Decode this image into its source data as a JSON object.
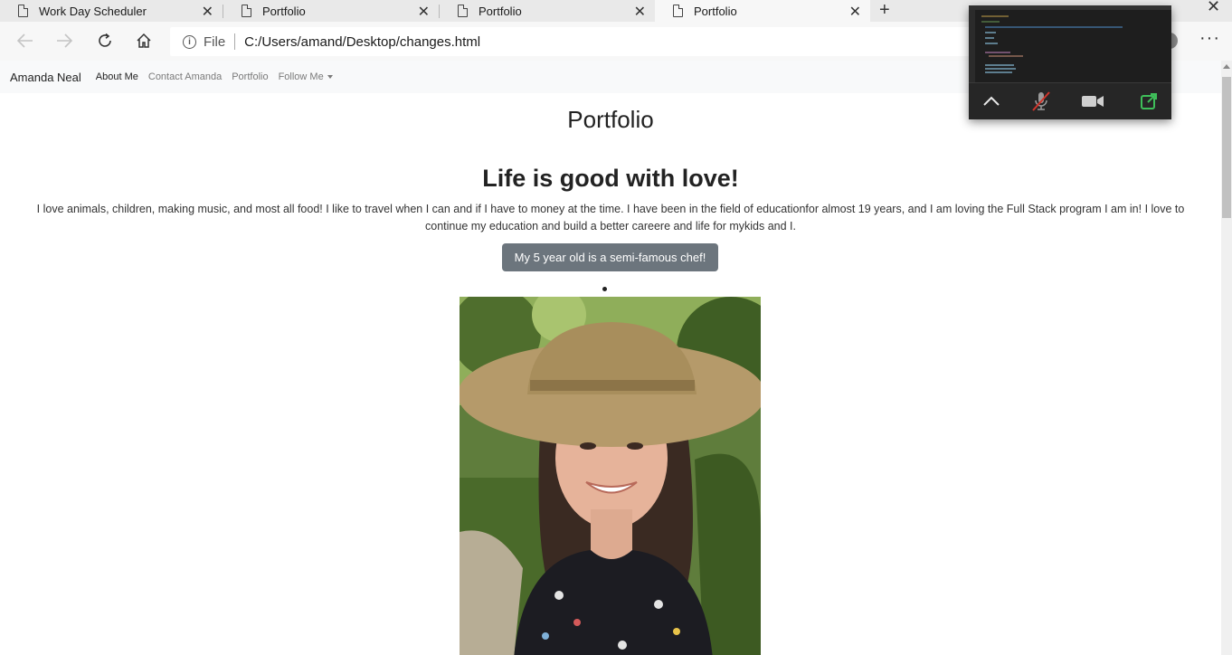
{
  "browser": {
    "tabs": [
      {
        "title": "Work Day Scheduler",
        "active": false
      },
      {
        "title": "Portfolio",
        "active": false
      },
      {
        "title": "Portfolio",
        "active": false
      },
      {
        "title": "Portfolio",
        "active": true
      }
    ],
    "address": {
      "scheme_label": "File",
      "url": "C:/Users/amand/Desktop/changes.html"
    }
  },
  "site": {
    "brand": "Amanda Neal",
    "nav": [
      {
        "label": "About Me",
        "active": true
      },
      {
        "label": "Contact Amanda",
        "active": false
      },
      {
        "label": "Portfolio",
        "active": false
      },
      {
        "label": "Follow Me",
        "active": false,
        "dropdown": true
      }
    ],
    "page_title": "Portfolio",
    "section_title": "Life is good with love!",
    "about_text": "I love animals, children, making music, and most all food! I like to travel when I can and if I have to money at the time. I have been in the field of educationfor almost 19 years, and I am loving the Full Stack program I am in! I love to continue my education and build a better careere and life for mykids and I.",
    "chef_button": "My 5 year old is a semi-famous chef!"
  },
  "meeting": {
    "controls": [
      "chevron-up-icon",
      "mic-muted-icon",
      "video-camera-icon",
      "share-screen-icon"
    ]
  },
  "colors": {
    "chef_button_bg": "#6c757d",
    "navbar_bg": "#f8f9fa",
    "share_icon": "#3fbf5a",
    "mute_slash": "#d0352b"
  }
}
